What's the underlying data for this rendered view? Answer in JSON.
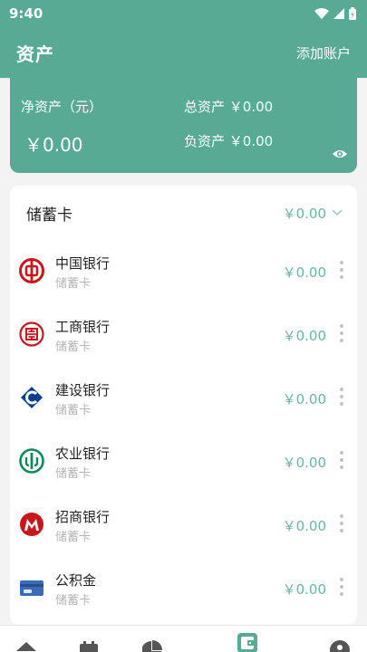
{
  "status_bar": {
    "time": "9:40"
  },
  "header": {
    "title": "资产",
    "action": "添加账户"
  },
  "summary": {
    "net_label": "净资产（元）",
    "net_value": "￥0.00",
    "total_label": "总资产",
    "total_value": "￥0.00",
    "liability_label": "负资产",
    "liability_value": "￥0.00"
  },
  "group": {
    "title": "储蓄卡",
    "total": "￥0.00"
  },
  "accounts": [
    {
      "name": "中国银行",
      "type": "储蓄卡",
      "amount": "￥0.00",
      "icon": "boc-logo-icon"
    },
    {
      "name": "工商银行",
      "type": "储蓄卡",
      "amount": "￥0.00",
      "icon": "icbc-logo-icon"
    },
    {
      "name": "建设银行",
      "type": "储蓄卡",
      "amount": "￥0.00",
      "icon": "ccb-logo-icon"
    },
    {
      "name": "农业银行",
      "type": "储蓄卡",
      "amount": "￥0.00",
      "icon": "abc-logo-icon"
    },
    {
      "name": "招商银行",
      "type": "储蓄卡",
      "amount": "￥0.00",
      "icon": "cmb-logo-icon"
    },
    {
      "name": "公积金",
      "type": "储蓄卡",
      "amount": "￥0.00",
      "icon": "card-icon"
    }
  ],
  "colors": {
    "accent": "#58aa94",
    "amount": "#6fb3a2",
    "boc": "#c8161d",
    "ccb": "#0b3d91",
    "abc": "#0f8a5f"
  }
}
